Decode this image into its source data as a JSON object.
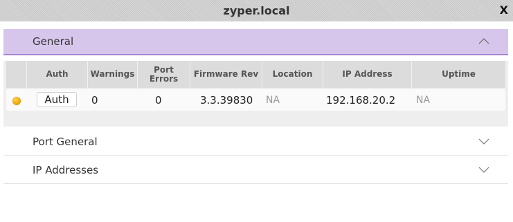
{
  "window": {
    "title": "zyper.local",
    "close_label": "X"
  },
  "sections": {
    "general": {
      "label": "General",
      "expanded": true
    },
    "port_general": {
      "label": "Port General",
      "expanded": false
    },
    "ip_addresses": {
      "label": "IP Addresses",
      "expanded": false
    }
  },
  "table": {
    "columns": {
      "auth": "Auth",
      "warnings": "Warnings",
      "port_errors": "Port Errors",
      "firmware_rev": "Firmware Rev",
      "location": "Location",
      "ip_address": "IP Address",
      "uptime": "Uptime"
    },
    "row": {
      "status_icon": "status-orange-dot",
      "auth_button": "Auth",
      "warnings": "0",
      "port_errors": "0",
      "firmware_rev": "3.3.39830",
      "location": "NA",
      "ip_address": "192.168.20.2",
      "uptime": "NA"
    }
  },
  "colors": {
    "accent_header_bg": "#d7c6ec",
    "accent_header_border": "#a585cf",
    "status_dot": "#f0a500"
  }
}
